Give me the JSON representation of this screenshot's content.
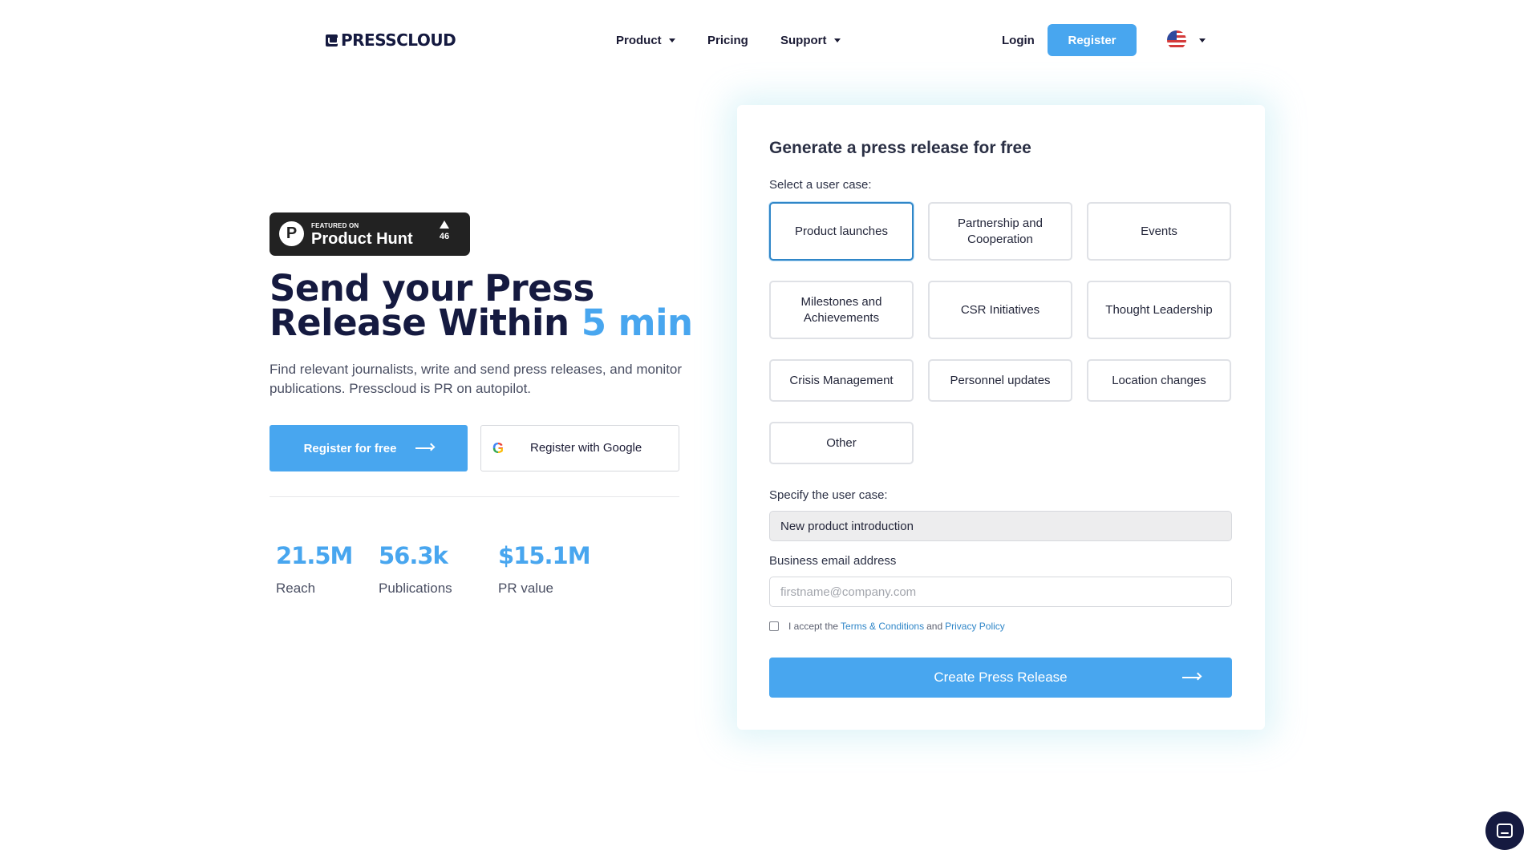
{
  "header": {
    "logo_text": "PRESSCLOUD",
    "nav": {
      "product": "Product",
      "pricing": "Pricing",
      "support": "Support"
    },
    "login": "Login",
    "register": "Register",
    "language_icon": "us-flag-icon"
  },
  "hero": {
    "badge": {
      "featured_on": "FEATURED ON",
      "name": "Product Hunt",
      "votes": "46"
    },
    "title_part1": "Send your Press Release Within ",
    "title_accent": "5 min",
    "subtitle": "Find relevant journalists, write and send press releases, and monitor publications. Presscloud is PR on autopilot.",
    "register_free": "Register for free",
    "register_google": "Register with Google",
    "stats": [
      {
        "value": "21.5M",
        "label": "Reach"
      },
      {
        "value": "56.3k",
        "label": "Publications"
      },
      {
        "value": "$15.1M",
        "label": "PR value"
      }
    ]
  },
  "form": {
    "title": "Generate a press release for free",
    "select_label": "Select a user case:",
    "cases": [
      "Product launches",
      "Partnership and Cooperation",
      "Events",
      "Milestones and Achievements",
      "CSR Initiatives",
      "Thought Leadership",
      "Crisis Management",
      "Personnel updates",
      "Location changes",
      "Other"
    ],
    "selected_case": "Product launches",
    "specify_label": "Specify the user case:",
    "specify_value": "New product introduction",
    "email_label": "Business email address",
    "email_placeholder": "firstname@company.com",
    "terms_prefix": "I accept the",
    "terms_link": "Terms & Conditions",
    "terms_and": "and",
    "privacy_link": "Privacy Policy",
    "submit": "Create Press Release"
  },
  "colors": {
    "accent": "#48a6ef",
    "dark": "#151a40"
  }
}
